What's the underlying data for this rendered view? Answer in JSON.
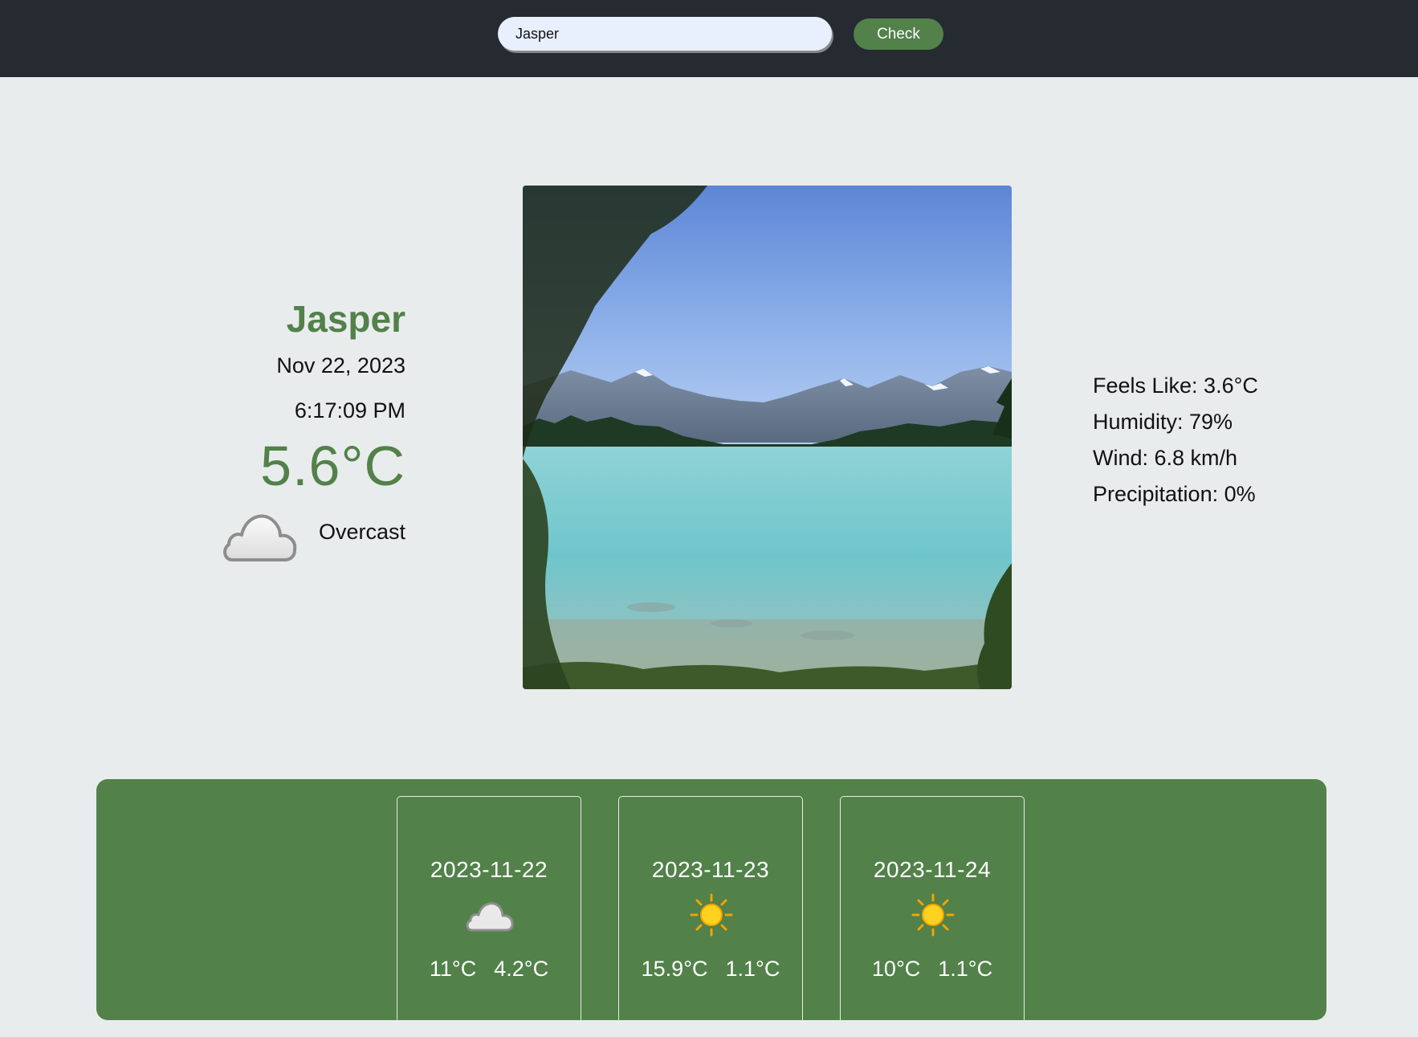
{
  "search": {
    "value": "Jasper",
    "button_label": "Check"
  },
  "current": {
    "city": "Jasper",
    "date": "Nov 22, 2023",
    "time": "6:17:09 PM",
    "temperature": "5.6°C",
    "condition": "Overcast",
    "condition_icon": "cloud-icon"
  },
  "photo": {
    "subject": "mountain-lake-landscape"
  },
  "details": {
    "feels_like": "Feels Like: 3.6°C",
    "humidity": "Humidity: 79%",
    "wind": "Wind: 6.8 km/h",
    "precipitation": "Precipitation: 0%"
  },
  "forecast": [
    {
      "date": "2023-11-22",
      "icon": "cloud-icon",
      "high": "11°C",
      "low": "4.2°C"
    },
    {
      "date": "2023-11-23",
      "icon": "sun-icon",
      "high": "15.9°C",
      "low": "1.1°C"
    },
    {
      "date": "2023-11-24",
      "icon": "sun-icon",
      "high": "10°C",
      "low": "1.1°C"
    }
  ],
  "colors": {
    "topbar": "#262a31",
    "accent_green": "#52814a",
    "page_background": "#e9eced",
    "input_background": "#e8f0fe"
  }
}
